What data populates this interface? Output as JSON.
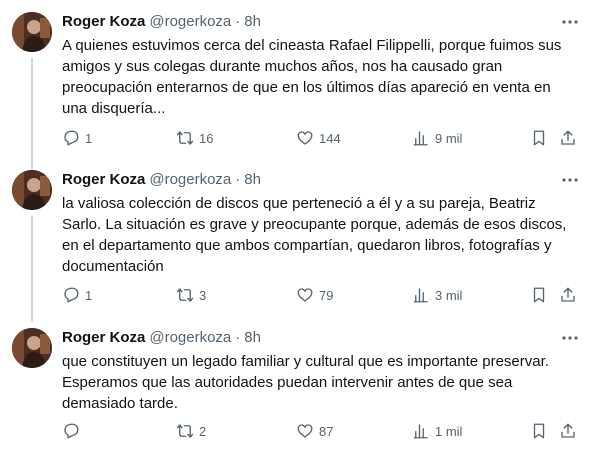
{
  "tweets": [
    {
      "author": "Roger Koza",
      "handle": "@rogerkoza",
      "dot": "·",
      "time": "8h",
      "text": "A quienes estuvimos cerca del cineasta Rafael Filippelli, porque fuimos sus\namigos y sus colegas durante muchos años, nos ha causado gran\npreocupación enterarnos de que en los últimos días apareció en venta en\nuna disquería...",
      "replies": "1",
      "retweets": "16",
      "likes": "144",
      "views": "9 mil"
    },
    {
      "author": "Roger Koza",
      "handle": "@rogerkoza",
      "dot": "·",
      "time": "8h",
      "text": "la valiosa colección de discos que perteneció a él y a su pareja, Beatriz\nSarlo. La situación es grave y preocupante porque, además de esos discos,\nen el departamento que ambos compartían, quedaron libros, fotografías y\ndocumentación",
      "replies": "1",
      "retweets": "3",
      "likes": "79",
      "views": "3 mil"
    },
    {
      "author": "Roger Koza",
      "handle": "@rogerkoza",
      "dot": "·",
      "time": "8h",
      "text": "que constituyen un legado familiar y cultural que es importante preservar.\nEsperamos que las autoridades puedan intervenir antes de que sea\ndemasiado tarde.",
      "replies": "",
      "retweets": "2",
      "likes": "87",
      "views": "1 mil"
    }
  ],
  "icons": {
    "reply": "reply-icon",
    "retweet": "retweet-icon",
    "like": "heart-icon",
    "views": "views-icon",
    "bookmark": "bookmark-icon",
    "share": "share-icon",
    "more": "more-dots-icon"
  },
  "colors": {
    "text": "#0f1419",
    "secondary": "#536471",
    "thread_line": "#cfd9de"
  }
}
